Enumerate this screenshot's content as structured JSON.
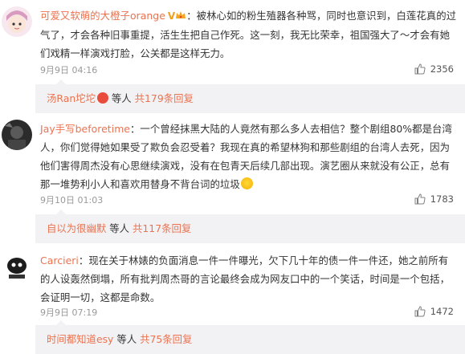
{
  "comments": [
    {
      "username": "可爱又软萌的大橙子orange",
      "text_before_emoji": "：被林心如的粉生殖器各种骂，同时也意识到，白莲花真的过气了，才会各种旧事重提，活生生把自己作死。这一刻，我无比荣幸，祖国强大了～才会有她们戏精一样演戏打脸，公关都是这样无力。",
      "text_after_emoji": "",
      "time": "9月9日 04:16",
      "likes": "2356",
      "reply_name": "汤Ran坨坨",
      "reply_others": "等人",
      "reply_total": "共179条回复"
    },
    {
      "username": "Jay手写beforetime",
      "text_before_emoji": "：一个曾经抹黑大陆的人竟然有那么多人去相信？整个剧组80%都是台湾人，你们觉得她如果受了欺负会忍受着？我现在真的希望林狗和那些剧组的台湾人去死，因为他们害得周杰没有心思继续演戏，没有在包青天后续几部出现。演艺圈从来就没有公正，总有那一堆势利小人和喜欢用替身不背台词的垃圾",
      "text_after_emoji": "",
      "time": "9月10日 01:03",
      "likes": "1783",
      "reply_name": "自以为很幽默",
      "reply_others": "等人",
      "reply_total": "共117条回复"
    },
    {
      "username": "Carcieri",
      "text_before_emoji": "：现在关于林婊的负面消息一件一件曝光，欠下几十年的债一件一件还，她之前所有的人设轰然倒塌，所有批判周杰哥的言论最终会成为网友口中的一个笑话，时间是一个包括，会证明一切，这都是命数。",
      "text_after_emoji": "",
      "time": "9月9日 07:19",
      "likes": "1472",
      "reply_name": "时间都知道esy",
      "reply_others": "等人",
      "reply_total": "共75条回复"
    }
  ],
  "icons": {
    "like": "thumbs-up-icon",
    "vip": "vip-badge-icon",
    "crown": "crown-icon"
  },
  "colors": {
    "username": "#eb7350",
    "reply_bg": "#f2f2f5",
    "meta": "#999999"
  }
}
